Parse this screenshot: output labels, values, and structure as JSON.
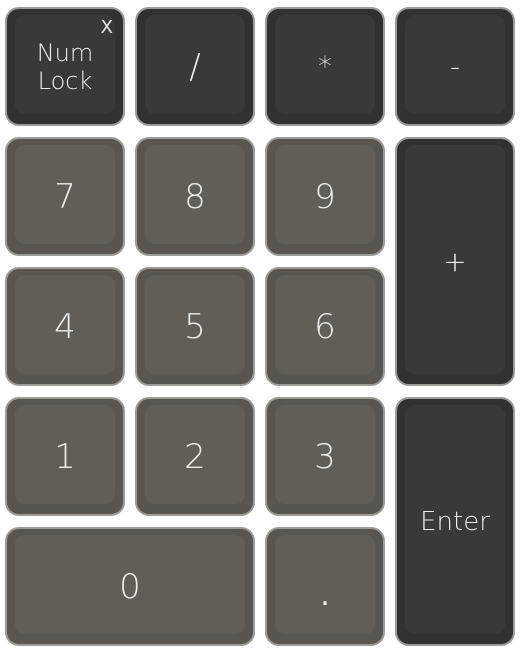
{
  "keypad": {
    "numlock": {
      "label": "Num\nLock",
      "indicator": "X"
    },
    "divide": {
      "label": "/"
    },
    "multiply": {
      "label": "*"
    },
    "subtract": {
      "label": "-"
    },
    "key7": {
      "label": "7"
    },
    "key8": {
      "label": "8"
    },
    "key9": {
      "label": "9"
    },
    "add": {
      "label": "+"
    },
    "key4": {
      "label": "4"
    },
    "key5": {
      "label": "5"
    },
    "key6": {
      "label": "6"
    },
    "key1": {
      "label": "1"
    },
    "key2": {
      "label": "2"
    },
    "key3": {
      "label": "3"
    },
    "enter": {
      "label": "Enter"
    },
    "key0": {
      "label": "0"
    },
    "decimal": {
      "label": "."
    }
  },
  "colors": {
    "dark_key": "#2f3230",
    "light_key": "#595550",
    "key_border": "#9b9b98",
    "key_text": "#ececec"
  }
}
